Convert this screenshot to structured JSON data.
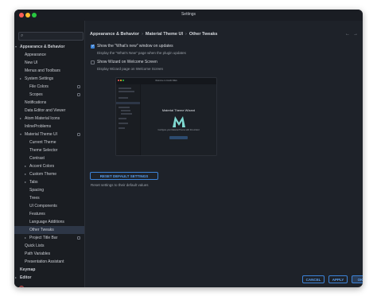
{
  "window": {
    "title": "Settings"
  },
  "search": {
    "placeholder": ""
  },
  "sidebar": {
    "items": [
      {
        "label": "Appearance & Behavior",
        "arrow": "▾",
        "badge": false,
        "bold": true
      },
      {
        "label": "Appearance",
        "arrow": "",
        "badge": false
      },
      {
        "label": "New UI",
        "arrow": "",
        "badge": false
      },
      {
        "label": "Menus and Toolbars",
        "arrow": "",
        "badge": false
      },
      {
        "label": "System Settings",
        "arrow": "▸",
        "badge": false
      },
      {
        "label": "File Colors",
        "arrow": "",
        "badge": true
      },
      {
        "label": "Scopes",
        "arrow": "",
        "badge": true
      },
      {
        "label": "Notifications",
        "arrow": "",
        "badge": false
      },
      {
        "label": "Data Editor and Viewer",
        "arrow": "",
        "badge": false
      },
      {
        "label": "Atom Material Icons",
        "arrow": "▸",
        "badge": false
      },
      {
        "label": "InlineProblems",
        "arrow": "",
        "badge": false
      },
      {
        "label": "Material Theme UI",
        "arrow": "▾",
        "badge": true
      },
      {
        "label": "Current Theme",
        "arrow": "",
        "badge": false
      },
      {
        "label": "Theme Selector",
        "arrow": "",
        "badge": false
      },
      {
        "label": "Contrast",
        "arrow": "",
        "badge": false
      },
      {
        "label": "Accent Colors",
        "arrow": "▸",
        "badge": false
      },
      {
        "label": "Custom Theme",
        "arrow": "▸",
        "badge": false
      },
      {
        "label": "Tabs",
        "arrow": "▸",
        "badge": false
      },
      {
        "label": "Spacing",
        "arrow": "",
        "badge": false
      },
      {
        "label": "Trees",
        "arrow": "",
        "badge": false
      },
      {
        "label": "UI Components",
        "arrow": "",
        "badge": false
      },
      {
        "label": "Features",
        "arrow": "",
        "badge": false
      },
      {
        "label": "Language Additions",
        "arrow": "",
        "badge": false
      },
      {
        "label": "Other Tweaks",
        "arrow": "",
        "badge": false,
        "selected": true
      },
      {
        "label": "Project Title Bar",
        "arrow": "▸",
        "badge": true
      },
      {
        "label": "Quick Lists",
        "arrow": "",
        "badge": false
      },
      {
        "label": "Path Variables",
        "arrow": "",
        "badge": false
      },
      {
        "label": "Presentation Assistant",
        "arrow": "",
        "badge": false
      },
      {
        "label": "Keymap",
        "arrow": "",
        "badge": false,
        "bold": true
      },
      {
        "label": "Editor",
        "arrow": "▸",
        "badge": false,
        "bold": true
      }
    ]
  },
  "breadcrumb": {
    "items": [
      "Appearance & Behavior",
      "Material Theme UI",
      "Other Tweaks"
    ]
  },
  "options": {
    "whats_new": {
      "label": "Show the \"What's new\" window on updates",
      "hint": "Display the \"What's New\" page when the plugin updates",
      "checked": true
    },
    "wizard": {
      "label": "Show Wizard on Welcome Screen",
      "hint": "Display Wizard page on Welcome Screen",
      "checked": false
    }
  },
  "preview": {
    "window_title": "Welcome to IntelliJ IDEA",
    "heading": "Material Theme Wizard",
    "desc": "Configure your Material Theme with this wizard"
  },
  "reset": {
    "button": "RESET DEFAULT SETTINGS",
    "hint": "Reset settings to their default values"
  },
  "footer": {
    "cancel": "CANCEL",
    "apply": "APPLY",
    "ok": "OK"
  },
  "colors": {
    "accent": "#3c83d8",
    "background": "#1e2229",
    "sidebar": "#1a1d22",
    "selection": "#2d3646"
  }
}
